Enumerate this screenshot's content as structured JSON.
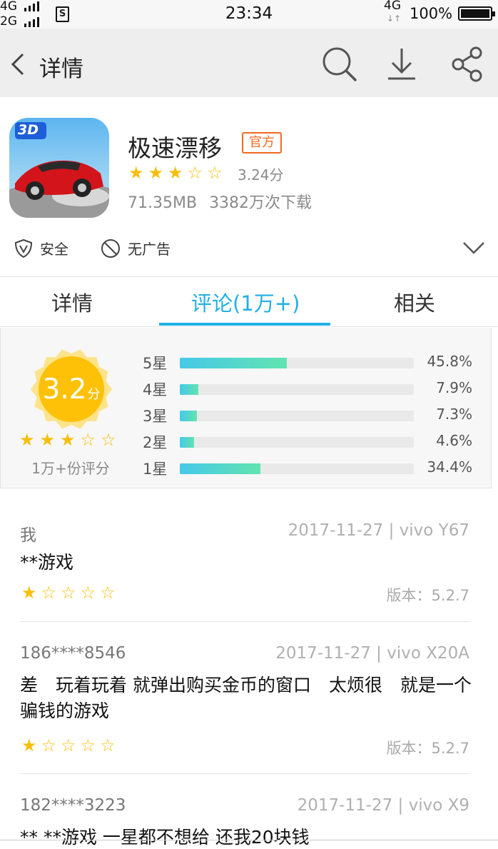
{
  "status_bar": {
    "net1": "4G",
    "net2": "2G",
    "sim_label": "S",
    "time": "23:34",
    "net_right": "4G",
    "battery": "100%"
  },
  "header": {
    "title": "详情"
  },
  "app": {
    "name": "极速漂移",
    "badge": "官方",
    "icon_label": "3D",
    "rating_stars": 3,
    "score": "3.24分",
    "size": "71.35MB",
    "downloads": "3382万次下载",
    "tags": [
      "安全",
      "无广告"
    ]
  },
  "tabs": [
    {
      "label": "详情",
      "active": false
    },
    {
      "label": "评论(1万+)",
      "active": true
    },
    {
      "label": "相关",
      "active": false
    }
  ],
  "rating_summary": {
    "score": "3.2",
    "unit": "分",
    "stars": 3,
    "count": "1万+份评分",
    "distribution": [
      {
        "label": "5星",
        "pct": "45.8%",
        "value": 45.8
      },
      {
        "label": "4星",
        "pct": "7.9%",
        "value": 7.9
      },
      {
        "label": "3星",
        "pct": "7.3%",
        "value": 7.3
      },
      {
        "label": "2星",
        "pct": "4.6%",
        "value": 4.6
      },
      {
        "label": "1星",
        "pct": "34.4%",
        "value": 34.4
      }
    ]
  },
  "reviews": [
    {
      "user": "我",
      "date": "2017-11-27 | vivo Y67",
      "text": "**游戏",
      "stars": 1,
      "version": "版本：5.2.7"
    },
    {
      "user": "186****8546",
      "date": "2017-11-27 | vivo X20A",
      "text": "差　玩着玩着 就弹出购买金币的窗口　太烦很　就是一个骗钱的游戏",
      "stars": 1,
      "version": "版本：5.2.7"
    },
    {
      "user": "182****3223",
      "date": "2017-11-27 | vivo X9",
      "text": "** **游戏 一星都不想给 还我20块钱"
    }
  ],
  "colors": {
    "accent": "#1fb2e8",
    "star": "#f7bf0a",
    "badge": "#f16a21",
    "score_badge": "#ffc107"
  }
}
